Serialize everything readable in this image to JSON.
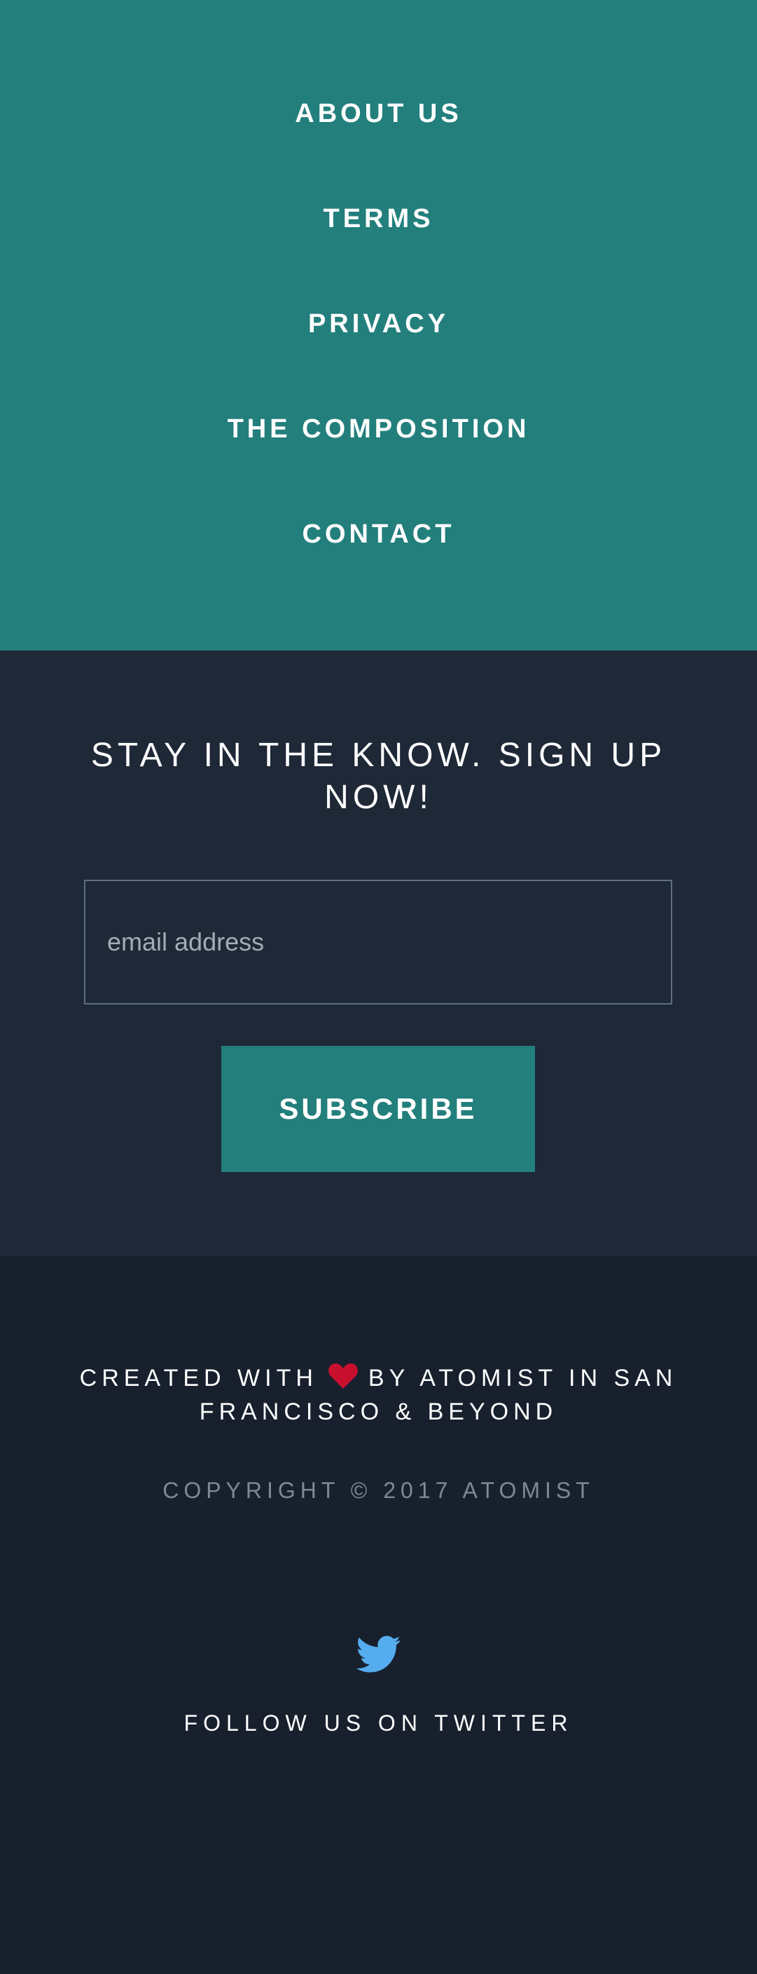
{
  "nav": {
    "links": [
      {
        "label": "ABOUT US"
      },
      {
        "label": "TERMS"
      },
      {
        "label": "PRIVACY"
      },
      {
        "label": "THE COMPOSITION"
      },
      {
        "label": "CONTACT"
      }
    ]
  },
  "signup": {
    "heading": "STAY IN THE KNOW. SIGN UP NOW!",
    "email_placeholder": "email address",
    "subscribe_label": "SUBSCRIBE"
  },
  "footer": {
    "created_prefix": "CREATED WITH",
    "created_suffix": "BY ATOMIST IN SAN FRANCISCO & BEYOND",
    "heart_icon": "heart-icon",
    "copyright": "COPYRIGHT © 2017 ATOMIST",
    "twitter_icon": "twitter-bird-icon",
    "twitter_label": "FOLLOW US ON TWITTER"
  },
  "colors": {
    "teal": "#237f7c",
    "navy": "#1e2837",
    "footer_navy": "#18202e",
    "heart_red": "#c8102e",
    "twitter_blue": "#55acee"
  }
}
